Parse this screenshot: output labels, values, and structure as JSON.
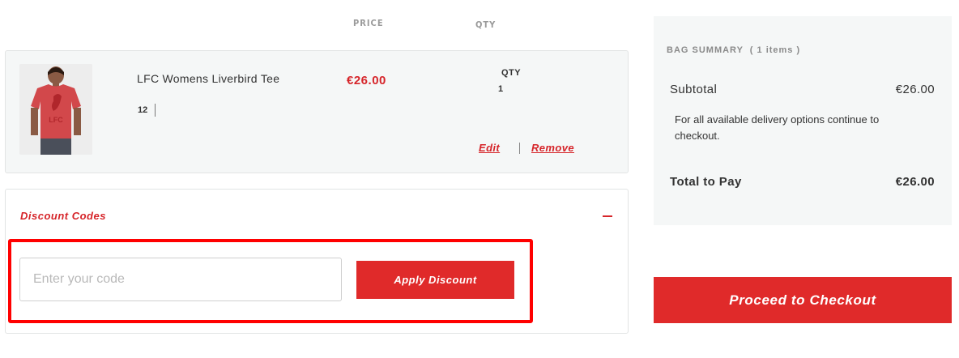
{
  "cart": {
    "headers": {
      "price": "PRICE",
      "qty": "QTY"
    },
    "item": {
      "name": "LFC Womens Liverbird Tee",
      "size": "12",
      "price": "€26.00",
      "qty_label": "QTY",
      "qty": "1",
      "edit_label": "Edit",
      "remove_label": "Remove",
      "thumbnail_logo": "LFC"
    }
  },
  "discount": {
    "title": "Discount Codes",
    "input_placeholder": "Enter your code",
    "input_value": "",
    "apply_label": "Apply Discount",
    "collapse_icon": "minus-icon"
  },
  "summary": {
    "heading": "BAG SUMMARY",
    "item_count_text": "( 1 items )",
    "subtotal_label": "Subtotal",
    "subtotal_value": "€26.00",
    "delivery_note": "For all available delivery options continue to checkout.",
    "total_label": "Total to Pay",
    "total_value": "€26.00",
    "checkout_label": "Proceed to Checkout"
  },
  "colors": {
    "accent": "#e02a2a",
    "price_red": "#d6252a",
    "panel_bg": "#f5f7f7",
    "highlight": "#ff0000"
  }
}
